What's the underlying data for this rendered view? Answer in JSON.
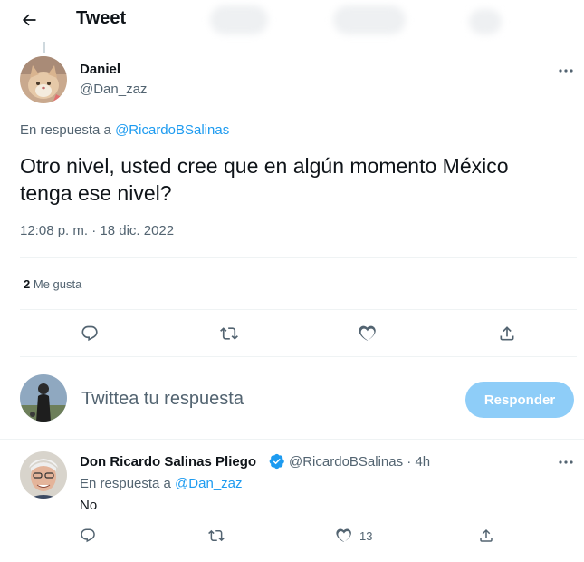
{
  "header": {
    "title": "Tweet"
  },
  "main_tweet": {
    "author_name": "Daniel",
    "author_handle": "@Dan_zaz",
    "reply_prefix": "En respuesta a",
    "reply_to_handle": "@RicardoBSalinas",
    "text": "Otro nivel, usted cree que en algún momento México tenga ese nivel?",
    "timestamp": "12:08 p. m. · 18 dic. 2022",
    "likes_count": "2",
    "likes_label": "Me gusta"
  },
  "composer": {
    "placeholder": "Twittea tu respuesta",
    "button_label": "Responder"
  },
  "reply_tweet": {
    "author_name": "Don Ricardo Salinas Pliego",
    "author_handle_time": "@RicardoBSalinas · 4h",
    "reply_prefix": "En respuesta a",
    "reply_to_handle": "@Dan_zaz",
    "text": "No",
    "like_count": "13"
  },
  "colors": {
    "accent": "#1d9bf0",
    "reply_button_disabled": "#8ecdf8",
    "secondary_text": "#536471",
    "verified": "#1d9bf0"
  },
  "icons": {
    "back": "arrow-left-icon",
    "more": "more-horizontal-icon",
    "reply": "reply-icon",
    "retweet": "retweet-icon",
    "like": "heart-icon",
    "share": "share-icon",
    "verified": "verified-badge-icon"
  }
}
